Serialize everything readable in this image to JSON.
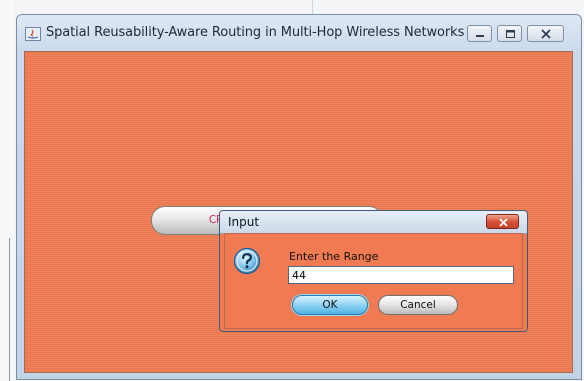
{
  "window": {
    "title": "Spatial Reusability-Aware Routing in Multi-Hop Wireless Networks",
    "app_icon": "java-app-icon",
    "controls": [
      "minimize-icon",
      "maximize-icon",
      "close-icon"
    ]
  },
  "main": {
    "create_button_label": "CREATE THREE NODES",
    "background_color": "#f07b52",
    "button_text_color": "#d8235a"
  },
  "dialog": {
    "title": "Input",
    "icon": "question-icon",
    "prompt": "Enter the Range",
    "input_value": "44",
    "ok_label": "OK",
    "cancel_label": "Cancel"
  }
}
